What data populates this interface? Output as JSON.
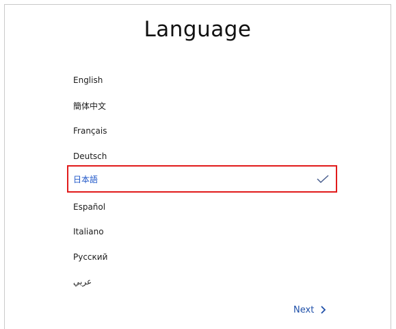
{
  "window": {
    "title": "Language"
  },
  "languages": [
    {
      "label": "English"
    },
    {
      "label": "簡体中文"
    },
    {
      "label": "Français"
    },
    {
      "label": "Deutsch"
    },
    {
      "label": "日本語",
      "selected": true
    },
    {
      "label": "Español"
    },
    {
      "label": "Italiano"
    },
    {
      "label": "Русский"
    },
    {
      "label": "عربي"
    }
  ],
  "footer": {
    "next_label": "Next"
  },
  "colors": {
    "selected_text": "#1e56c8",
    "highlight_border": "#e11a1a",
    "next_text": "#1e4fa8"
  },
  "icons": {
    "selected_check": "checkmark-icon",
    "next_arrow": "chevron-right-icon"
  }
}
